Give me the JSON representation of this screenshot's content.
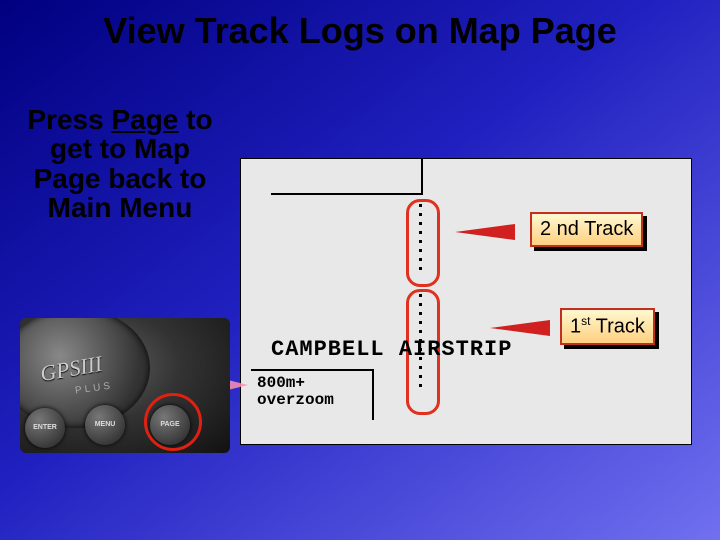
{
  "title": "View Track Logs on Map Page",
  "instruction_html": "Press <u>Page</u> to get to Map Page back to Main Menu",
  "instruction_plain": "Press Page to get to Map Page back to Main Menu",
  "map": {
    "place_label": "CAMPBELL AIRSTRIP",
    "zoom_line1": "800m+",
    "zoom_line2": "overzoom"
  },
  "callouts": {
    "track2": "2 nd Track",
    "track1_prefix": "1",
    "track1_sup": "st",
    "track1_suffix": " Track"
  },
  "device": {
    "brand": "GPSIII",
    "subbrand": "PLUS",
    "buttons": {
      "enter": "ENTER",
      "menu": "MENU",
      "page": "PAGE"
    }
  }
}
